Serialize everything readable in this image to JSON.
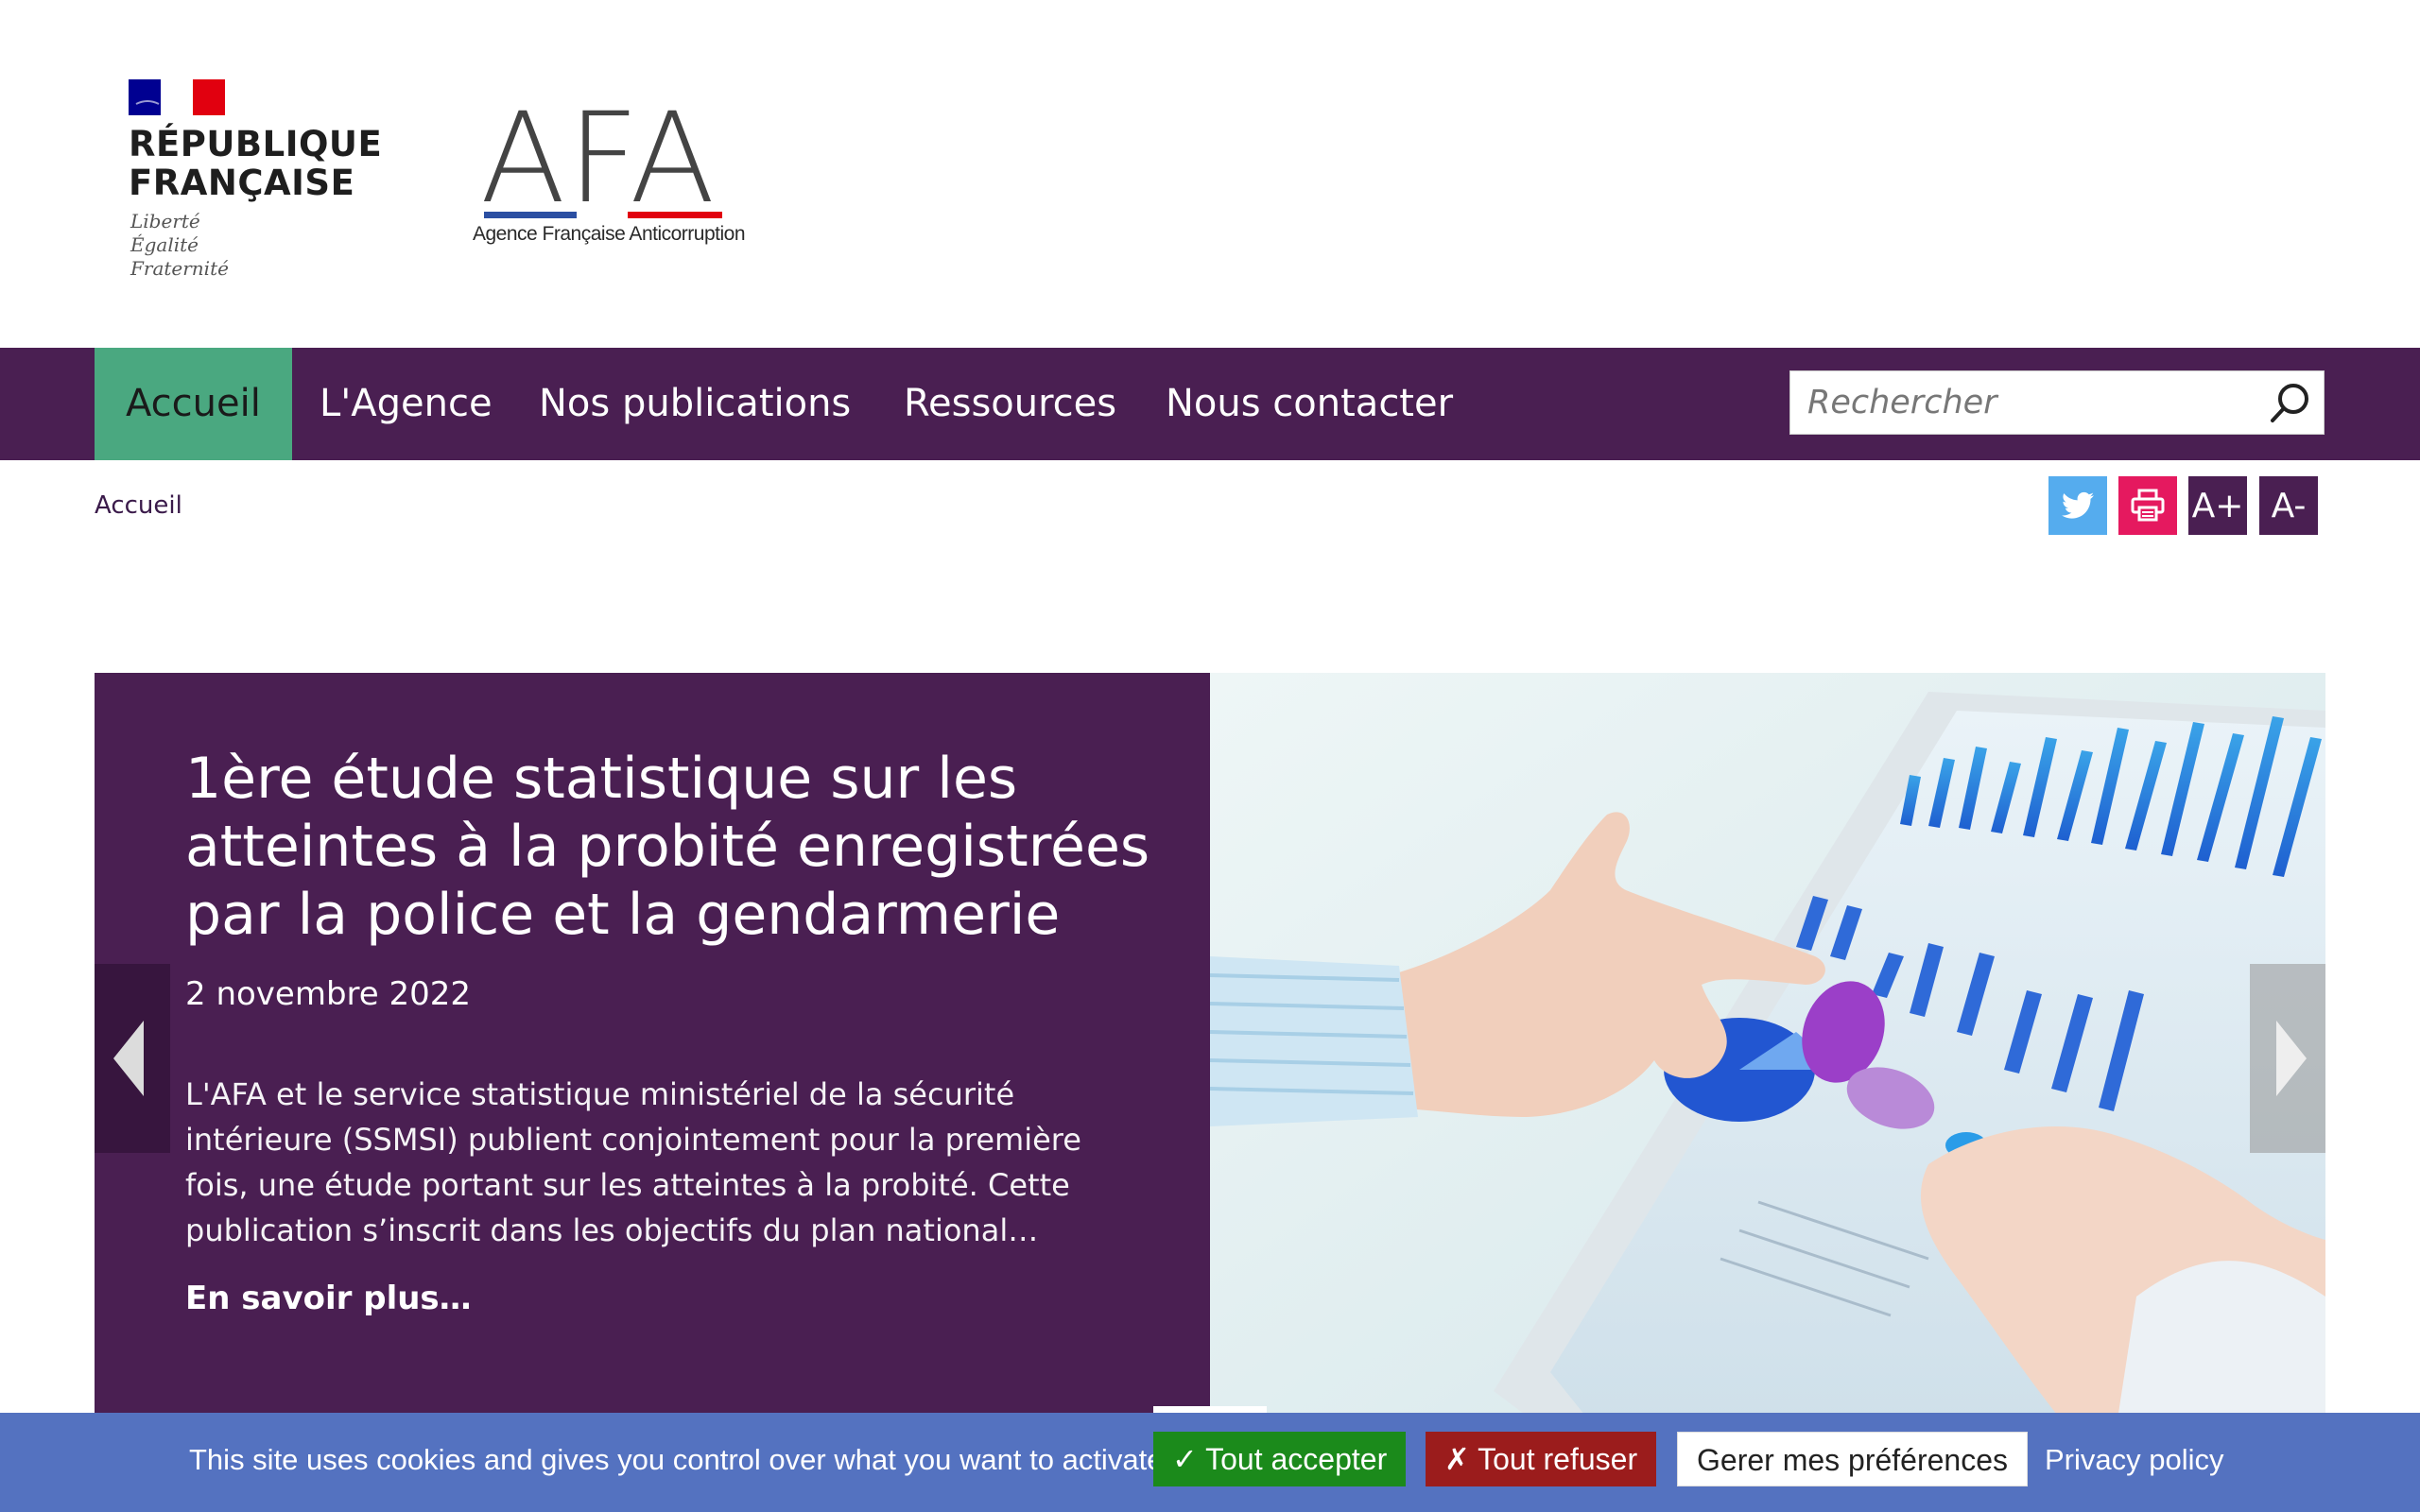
{
  "header": {
    "rf_logo": {
      "name": "RÉPUBLIQUE\nFRANÇAISE",
      "motto": "Liberté\nÉgalité\nFraternité"
    },
    "afa_logo": {
      "letters": "AFA",
      "subtitle": "Agence Française Anticorruption"
    }
  },
  "nav": {
    "items": [
      {
        "label": "Accueil",
        "active": true
      },
      {
        "label": "L'Agence",
        "active": false
      },
      {
        "label": "Nos publications",
        "active": false
      },
      {
        "label": "Ressources",
        "active": false
      },
      {
        "label": "Nous contacter",
        "active": false
      }
    ],
    "search": {
      "placeholder": "Rechercher",
      "value": "",
      "icon": "search-icon"
    }
  },
  "breadcrumb": {
    "current": "Accueil"
  },
  "tools": {
    "twitter_icon": "twitter-icon",
    "print_icon": "print-icon",
    "increase_label": "A+",
    "decrease_label": "A-",
    "colors": {
      "twitter": "#55acee",
      "print": "#e5195f",
      "brand": "#4a1f52"
    }
  },
  "slider": {
    "slide": {
      "title": "1ère étude statistique sur les atteintes à la probité enregistrées par la police et la gendarmerie",
      "date": "2 novembre 2022",
      "description": "L'AFA et le service statistique ministériel de la sécurité intérieure (SSMSI) publient conjointement pour la première fois, une étude portant sur les atteintes à la probité. Cette publication s’inscrit dans les objectifs du plan national…",
      "more_label": "En savoir plus…"
    },
    "prev_icon": "chevron-left-icon",
    "next_icon": "chevron-right-icon"
  },
  "cookie": {
    "message": "This site uses cookies and gives you control over what you want to activate",
    "accept_label": "✓ Tout accepter",
    "refuse_label": "✗ Tout refuser",
    "preferences_label": "Gerer mes préférences",
    "privacy_label": "Privacy policy",
    "colors": {
      "bar": "#5472c0",
      "accept": "#1b8a1b",
      "refuse": "#9b1c1c"
    }
  }
}
